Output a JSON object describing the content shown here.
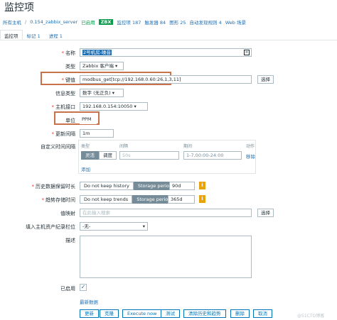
{
  "page_title": "监控项",
  "breadcrumb": {
    "all_hosts": "所有主机",
    "separator": "/",
    "host": "0.154_zabbix_server",
    "enabled": "已启用",
    "zbx": "ZBX",
    "items": "监控项 187",
    "triggers": "触发器 84",
    "graphs": "图形 25",
    "discovery": "自动发现规则 4",
    "web": "Web 场景"
  },
  "tabs": [
    "监控项",
    "标记 1",
    "进程 1"
  ],
  "form": {
    "name_label": "名称",
    "name_value": "2号机房-噪音",
    "type_label": "类型",
    "type_value": "Zabbix 客户端",
    "key_label": "键值",
    "key_value": "modbus_get[tcp://192.168.0.60:26,1,3,11]",
    "select_label": "选择",
    "info_type_label": "信息类型",
    "info_type_value": "数字 (无正负)",
    "host_iface_label": "主机接口",
    "host_iface_value": "192.168.0.154:10050",
    "units_label": "单位",
    "units_value": "PPM",
    "interval_label": "更新间隔",
    "interval_value": "1m",
    "custom_interval_label": "自定义时间间隔",
    "ci_col_type": "类型",
    "ci_col_interval": "间隔",
    "ci_col_period": "期间",
    "ci_col_action": "动作",
    "ci_flexible": "灵活",
    "ci_scheduling": "调度",
    "ci_interval_placeholder": "50s",
    "ci_period_placeholder": "1-7,00:00-24:00",
    "ci_remove": "移除",
    "ci_add": "添加",
    "history_label": "历史数据保留时长",
    "history_no_keep": "Do not keep history",
    "storage_period": "Storage period",
    "history_value": "90d",
    "trends_label": "趋势存储时间",
    "trends_no_keep": "Do not keep trends",
    "trends_value": "365d",
    "valuemap_label": "值映射",
    "valuemap_placeholder": "在此输入搜索",
    "inventory_label": "填入主机资产纪录栏位",
    "inventory_value": "-无-",
    "description_label": "描述",
    "enabled_label": "已启用",
    "latest_data": "最新数据"
  },
  "buttons": {
    "update": "更新",
    "clone": "克隆",
    "execute": "Execute now",
    "test": "测试",
    "clear": "清除历史和趋势",
    "delete": "删除",
    "cancel": "取消"
  },
  "watermark": "@51CTO博客"
}
